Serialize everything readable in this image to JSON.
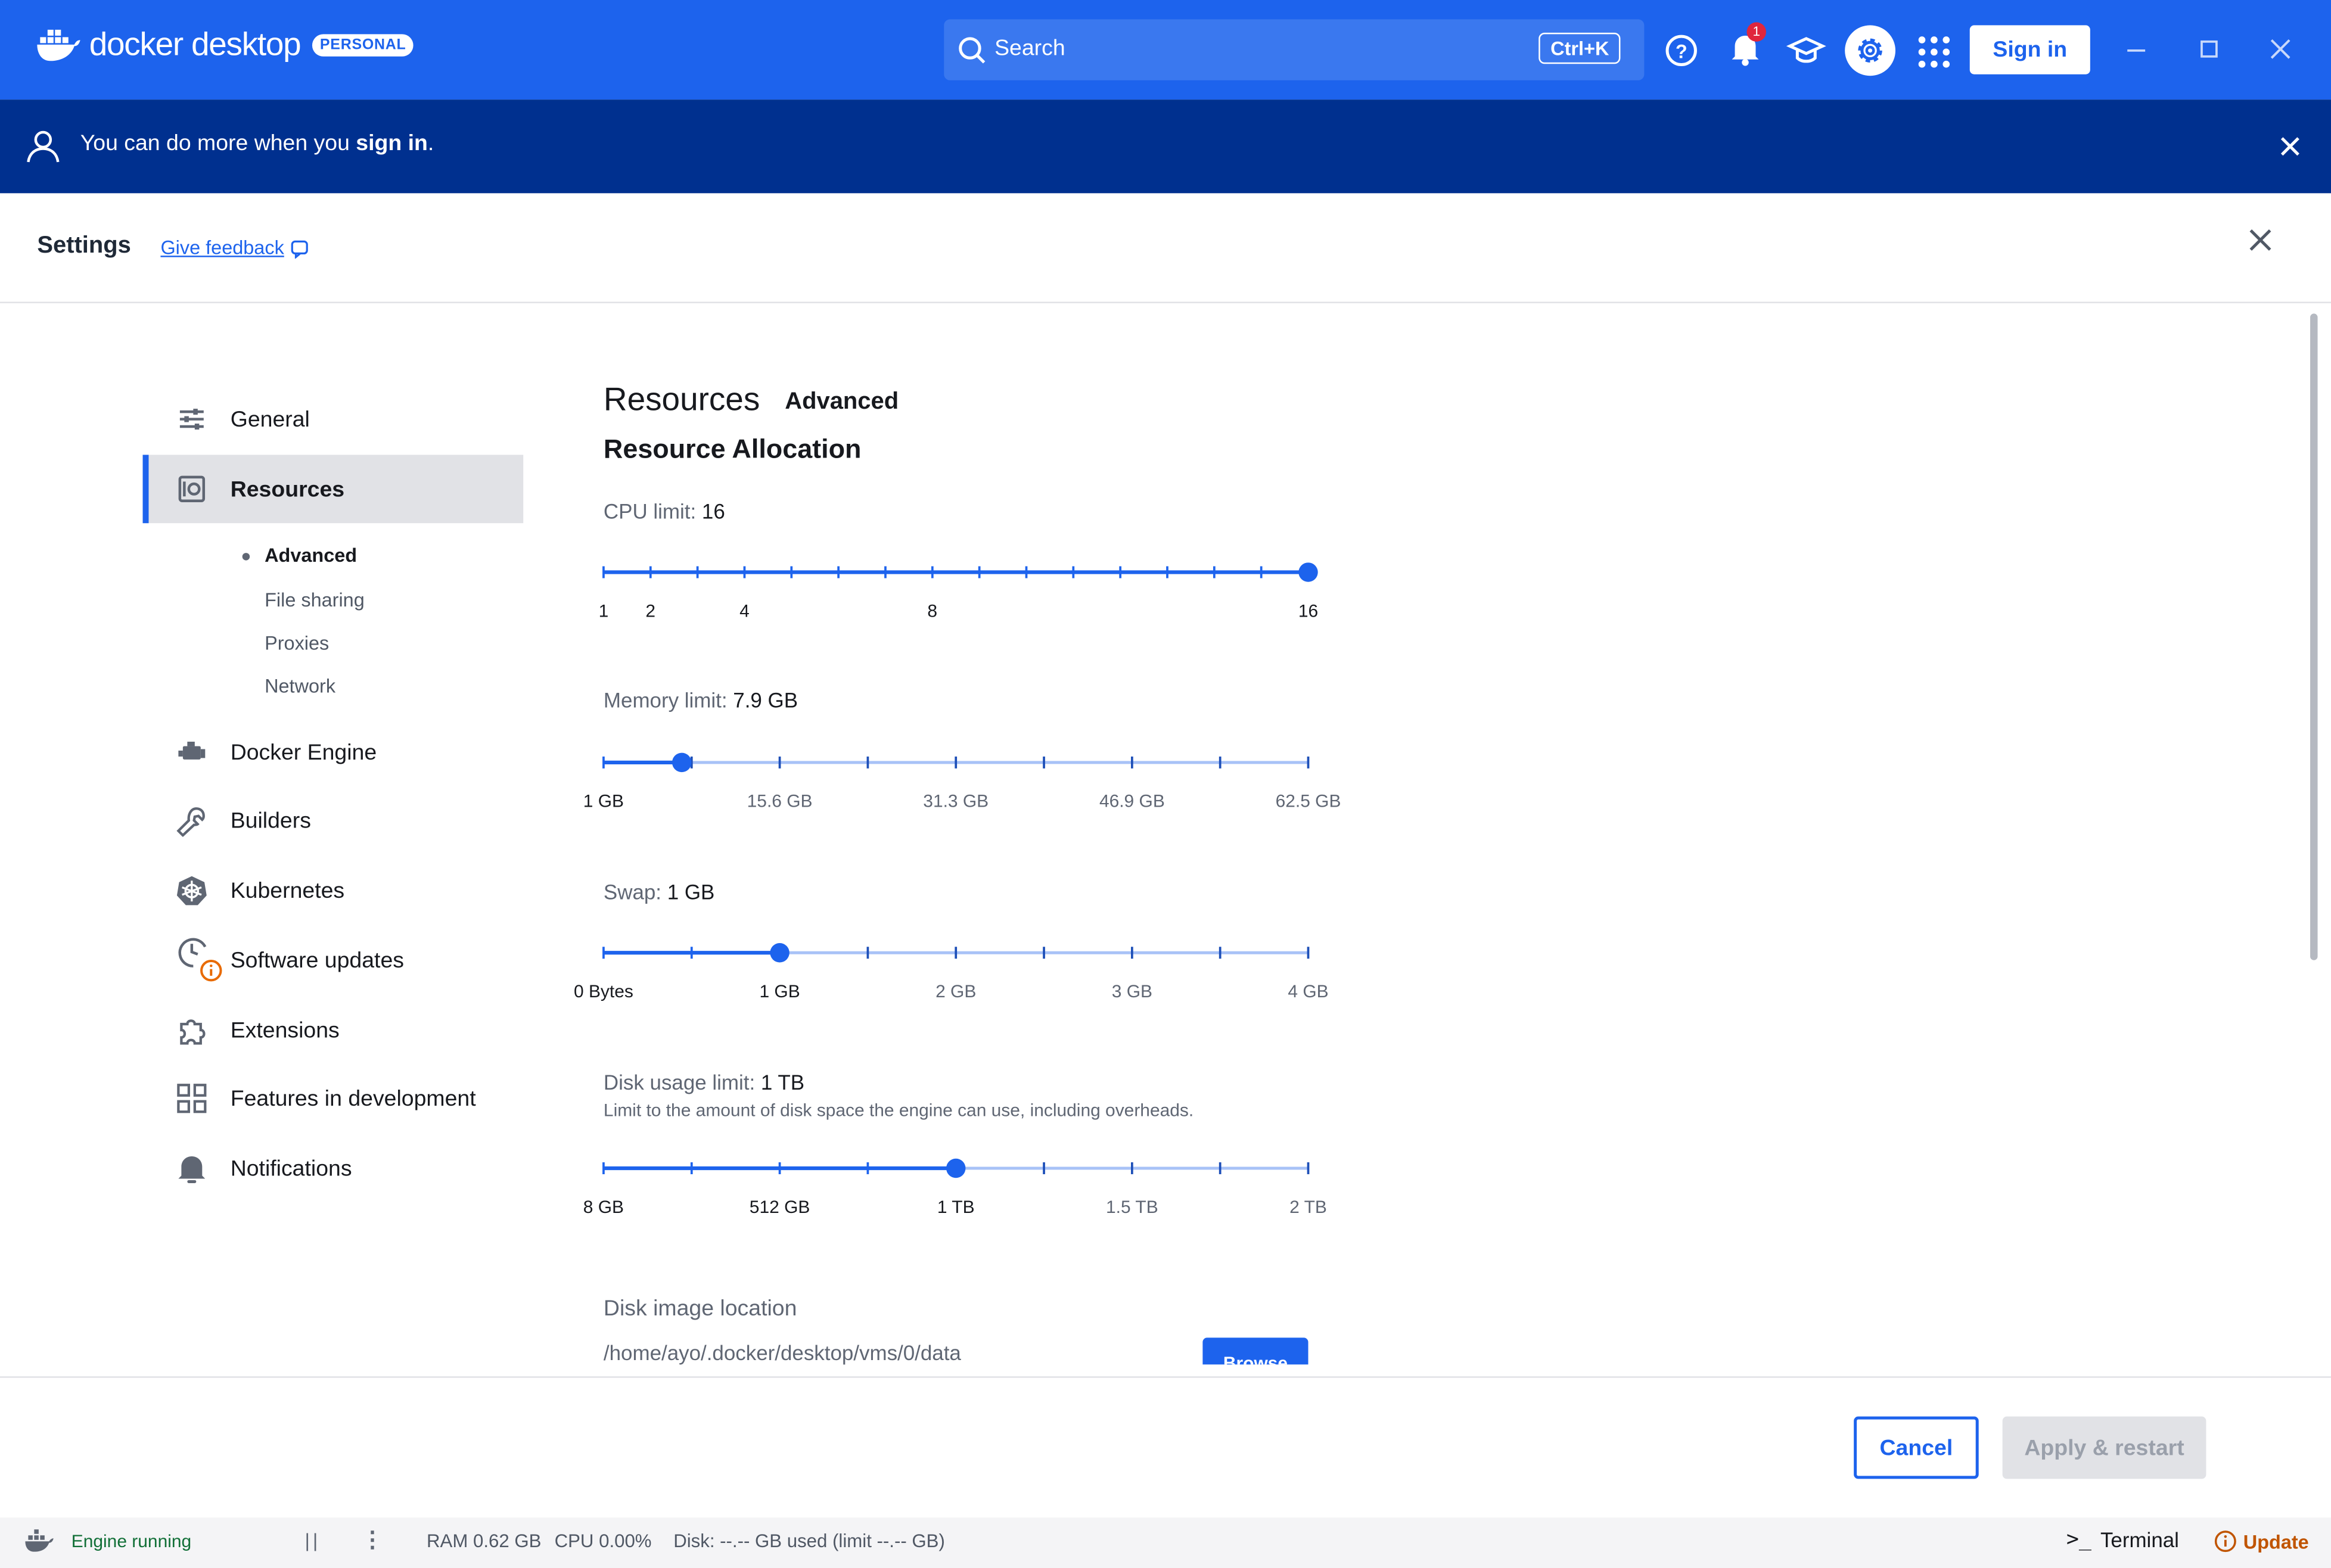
{
  "app": {
    "logo_text": "docker desktop",
    "badge": "PERSONAL",
    "search_placeholder": "Search",
    "search_shortcut": "Ctrl+K",
    "notification_count": "1",
    "sign_in_label": "Sign in"
  },
  "banner": {
    "text_pre": "You can do more when you ",
    "link": "sign in",
    "text_post": "."
  },
  "settings": {
    "title": "Settings",
    "feedback": "Give feedback"
  },
  "sidebar": {
    "items": [
      {
        "label": "General"
      },
      {
        "label": "Resources"
      },
      {
        "label": "Docker Engine"
      },
      {
        "label": "Builders"
      },
      {
        "label": "Kubernetes"
      },
      {
        "label": "Software updates"
      },
      {
        "label": "Extensions"
      },
      {
        "label": "Features in development"
      },
      {
        "label": "Notifications"
      }
    ],
    "subitems": [
      {
        "label": "Advanced"
      },
      {
        "label": "File sharing"
      },
      {
        "label": "Proxies"
      },
      {
        "label": "Network"
      }
    ]
  },
  "content": {
    "title": "Resources",
    "tab": "Advanced",
    "section": "Resource Allocation",
    "cpu": {
      "label": "CPU limit:",
      "value": "16",
      "ticks": [
        "1",
        "2",
        "4",
        "8",
        "16"
      ],
      "level": 1.0
    },
    "memory": {
      "label": "Memory limit:",
      "value": "7.9 GB",
      "ticks": [
        "1 GB",
        "15.6 GB",
        "31.3 GB",
        "46.9 GB",
        "62.5 GB"
      ],
      "level": 0.111
    },
    "swap": {
      "label": "Swap:",
      "value": "1 GB",
      "ticks": [
        "0 Bytes",
        "1 GB",
        "2 GB",
        "3 GB",
        "4 GB"
      ],
      "level": 0.25
    },
    "disk": {
      "label": "Disk usage limit:",
      "value": "1 TB",
      "description": "Limit to the amount of disk space the engine can use, including overheads.",
      "ticks": [
        "8 GB",
        "512 GB",
        "1 TB",
        "1.5 TB",
        "2 TB"
      ],
      "level": 0.5
    },
    "disk_image": {
      "label": "Disk image location",
      "path": "/home/ayo/.docker/desktop/vms/0/data",
      "browse": "Browse"
    }
  },
  "footer": {
    "cancel": "Cancel",
    "apply": "Apply & restart"
  },
  "status": {
    "engine": "Engine running",
    "pause": "||",
    "ram": "RAM 0.62 GB",
    "cpu": "CPU 0.00%",
    "disk": "Disk: --.-- GB used (limit --.-- GB)",
    "terminal": "Terminal",
    "update": "Update"
  },
  "colors": {
    "accent": "#1d63ed",
    "banner": "#00308f",
    "warning": "#e86a00"
  }
}
